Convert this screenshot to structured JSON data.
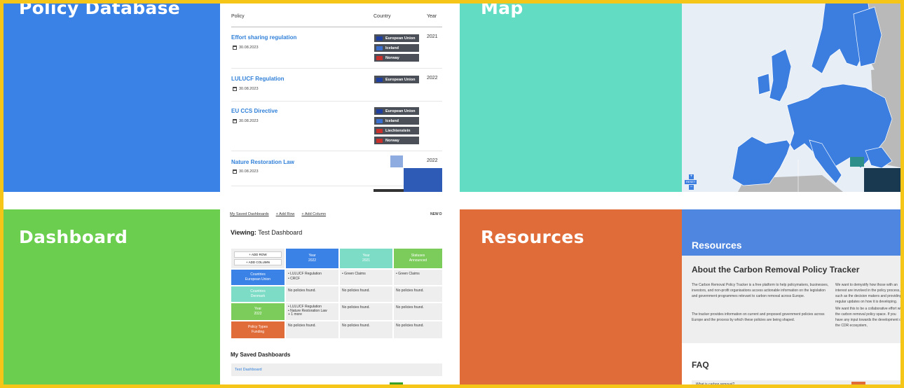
{
  "tiles": {
    "policy_database": "Policy Database",
    "map": "Map",
    "dashboard": "Dashboard",
    "resources": "Resources"
  },
  "policy_db": {
    "headers": {
      "policy": "Policy",
      "country": "Country",
      "year": "Year"
    },
    "rows": [
      {
        "name": "Effort sharing regulation",
        "date": "30.08.2023",
        "year": "2021",
        "countries": [
          "European Union",
          "Iceland",
          "Norway"
        ]
      },
      {
        "name": "LULUCF Regulation",
        "date": "30.08.2023",
        "year": "2022",
        "countries": [
          "European Union"
        ]
      },
      {
        "name": "EU CCS Directive",
        "date": "30.08.2023",
        "year": "",
        "countries": [
          "European Union",
          "Iceland",
          "Liechtenstein",
          "Norway"
        ]
      },
      {
        "name": "Nature Restoration Law",
        "date": "30.08.2023",
        "year": "2022",
        "countries": []
      }
    ]
  },
  "map_shot": {
    "reset_label": "RESET"
  },
  "dashboard_shot": {
    "toolbar": [
      "My Saved Dashboards",
      "+ Add Row",
      "+ Add Column"
    ],
    "toolbar_right": "NEW D",
    "viewing_label": "Viewing:",
    "viewing_name": "Test Dashboard",
    "add_row": "+ ADD ROW",
    "add_column": "+ ADD COLUMN",
    "col_headers": [
      {
        "title": "Year",
        "sub": "2022"
      },
      {
        "title": "Year",
        "sub": "2021"
      },
      {
        "title": "Statuses",
        "sub": "Announced"
      }
    ],
    "row_headers": [
      {
        "title": "Countries",
        "sub": "European Union"
      },
      {
        "title": "Countries",
        "sub": "Denmark"
      },
      {
        "title": "Year",
        "sub": "2022"
      },
      {
        "title": "Policy Types",
        "sub": "Funding"
      }
    ],
    "cells": [
      [
        "• LULUCF Regulation\n• CRCF",
        "• Green Claims",
        "• Green Claims"
      ],
      [
        "No policies found.",
        "No policies found.",
        "No policies found."
      ],
      [
        "• LULUCF Regulation\n• Nature Restoration Law\n+ 1 more",
        "No policies found.",
        "No policies found."
      ],
      [
        "No policies found.",
        "No policies found.",
        "No policies found."
      ]
    ],
    "saved_title": "My Saved Dashboards",
    "saved_item": "Test Dashboard"
  },
  "resources_shot": {
    "banner": "Resources",
    "heading": "About the Carbon Removal Policy Tracker",
    "para1": "The Carbon Removal Policy Tracker is a free platform to help policymakers, businesses, investors, and non-profit organisations access actionable information on the legislation and government programmes relevant to carbon removal across Europe.",
    "para2": "The tracker provides information on current and proposed government policies across Europe and the process by which these policies are being shaped.",
    "right1": "We want to demystify how those with an interest are involved in the policy process, such as the decision makers and providing regular updates on how it is developing.",
    "right2": "We want this to be a collaborative effort with the carbon removal policy space. If you have any input towards the development of the CDR ecosystem, contact@carbongap.org.",
    "faq": "FAQ",
    "faq_q": "What is carbon removal?"
  },
  "colors": {
    "frame": "#f5c518",
    "policy_database": "#3b82e6",
    "map": "#63dcc4",
    "dashboard": "#6cce4e",
    "resources": "#e06c3a"
  }
}
